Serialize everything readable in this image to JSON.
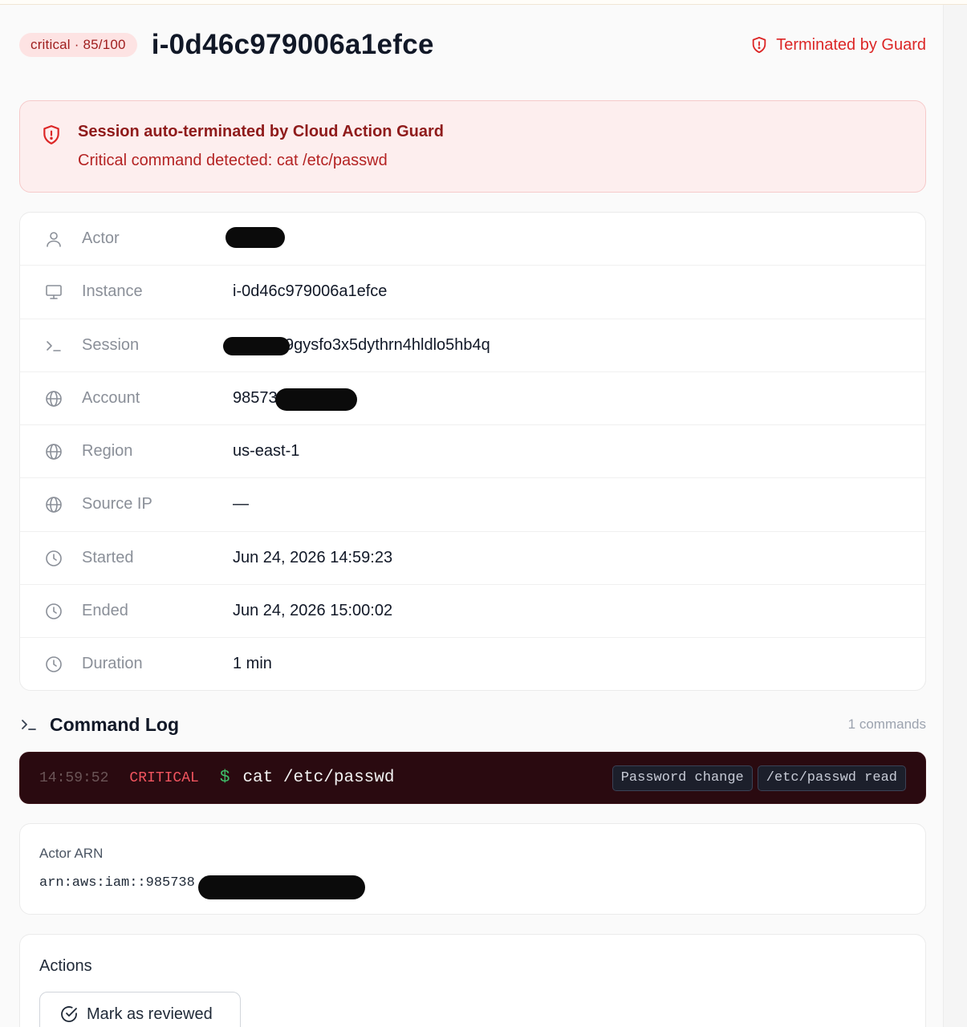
{
  "header": {
    "severity_badge": "critical · 85/100",
    "title": "i-0d46c979006a1efce",
    "status": "Terminated by Guard"
  },
  "alert": {
    "title": "Session auto-terminated by Cloud Action Guard",
    "message": "Critical command detected: cat /etc/passwd"
  },
  "details": [
    {
      "icon": "user-icon",
      "label": "Actor",
      "value": ""
    },
    {
      "icon": "monitor-icon",
      "label": "Instance",
      "value": "i-0d46c979006a1efce"
    },
    {
      "icon": "terminal-icon",
      "label": "Session",
      "value": "9gysfo3x5dythrn4hldlo5hb4q"
    },
    {
      "icon": "globe-icon",
      "label": "Account",
      "value": "98573"
    },
    {
      "icon": "globe-icon",
      "label": "Region",
      "value": "us-east-1"
    },
    {
      "icon": "globe-icon",
      "label": "Source IP",
      "value": "—"
    },
    {
      "icon": "clock-icon",
      "label": "Started",
      "value": "Jun 24, 2026 14:59:23"
    },
    {
      "icon": "clock-icon",
      "label": "Ended",
      "value": "Jun 24, 2026 15:00:02"
    },
    {
      "icon": "clock-icon",
      "label": "Duration",
      "value": "1 min"
    }
  ],
  "command_log": {
    "title": "Command Log",
    "count": "1 commands",
    "entries": [
      {
        "time": "14:59:52",
        "severity": "CRITICAL",
        "prompt": "$",
        "command": "cat /etc/passwd",
        "tags": [
          "Password change",
          "/etc/passwd read"
        ]
      }
    ]
  },
  "arn": {
    "label": "Actor ARN",
    "value": "arn:aws:iam::985738"
  },
  "actions": {
    "title": "Actions",
    "review_button": "Mark as reviewed"
  },
  "colors": {
    "critical_red": "#dc2626",
    "alert_bg": "#fdeeee",
    "command_bar_bg": "#2a0a10",
    "prompt_green": "#3fbf6a"
  }
}
